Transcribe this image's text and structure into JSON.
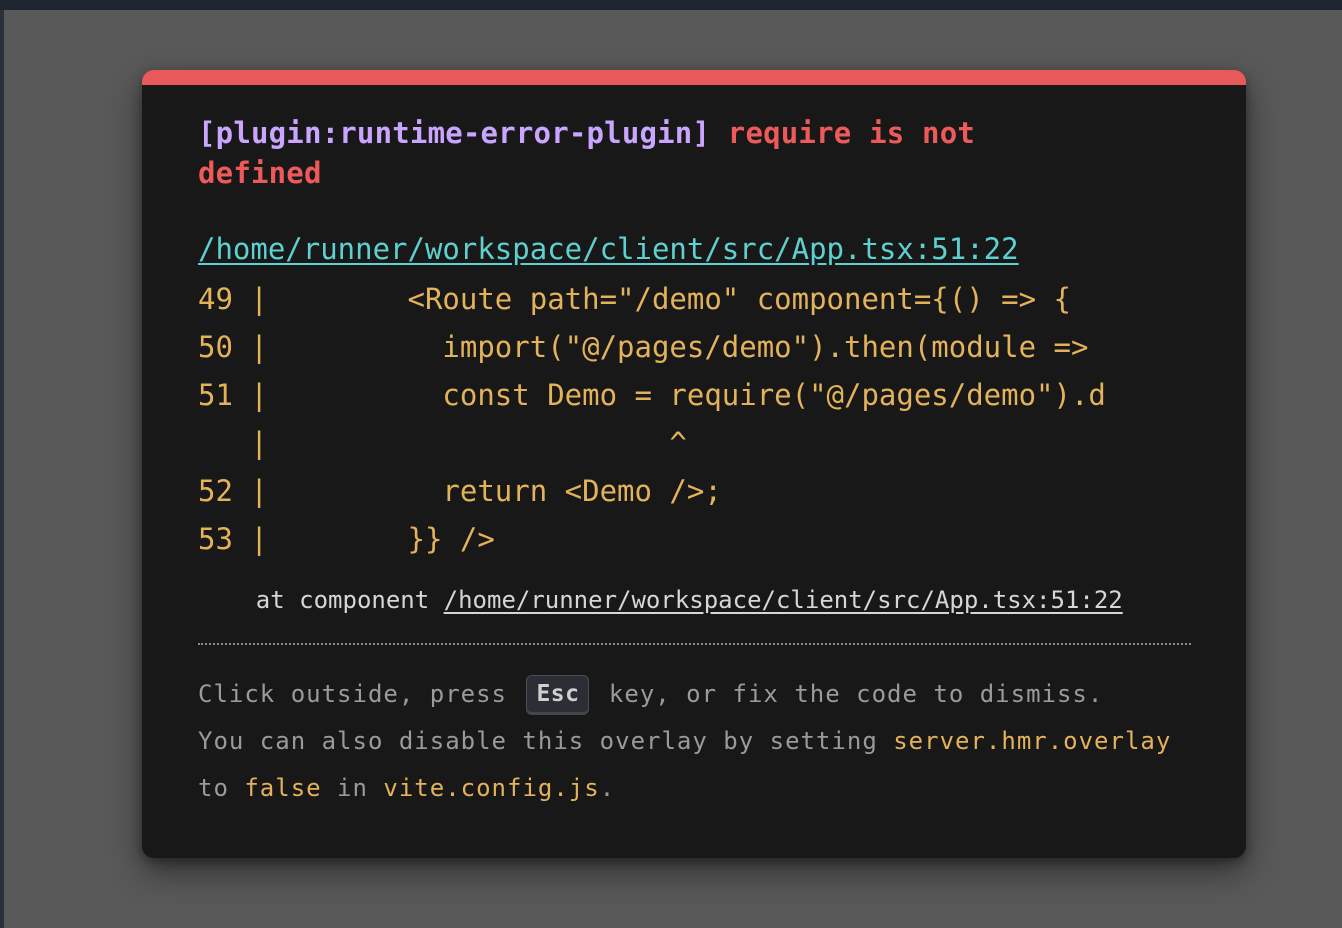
{
  "overlay": {
    "plugin_tag": "[plugin:runtime-error-plugin]",
    "message": "require is not defined",
    "file": "/home/runner/workspace/client/src/App.tsx:51:22",
    "frame_lines": [
      "49 |        <Route path=\"/demo\" component={() => {",
      "50 |          import(\"@/pages/demo\").then(module =>",
      "51 |          const Demo = require(\"@/pages/demo\").d",
      "   |                       ^",
      "52 |          return <Demo />;",
      "53 |        }} />"
    ],
    "stack_prefix": "    at component ",
    "stack_link": "/home/runner/workspace/client/src/App.tsx:51:22",
    "tip": {
      "part1": "Click outside, press ",
      "esc_key": "Esc",
      "part2": " key, or fix the code to dismiss.",
      "part3": "You can also disable this overlay by setting ",
      "config_key": "server.hmr.overlay",
      "part4": "to ",
      "false_value": "false",
      "part5": " in ",
      "config_file": "vite.config.js",
      "part6": "."
    }
  },
  "colors": {
    "accent_red": "#e85a5a",
    "plugin_purple": "#c9a5ff",
    "link_cyan": "#5ed0d0",
    "code_yellow": "#e3b25b",
    "overlay_bg": "#181818",
    "backdrop": "#595959"
  }
}
